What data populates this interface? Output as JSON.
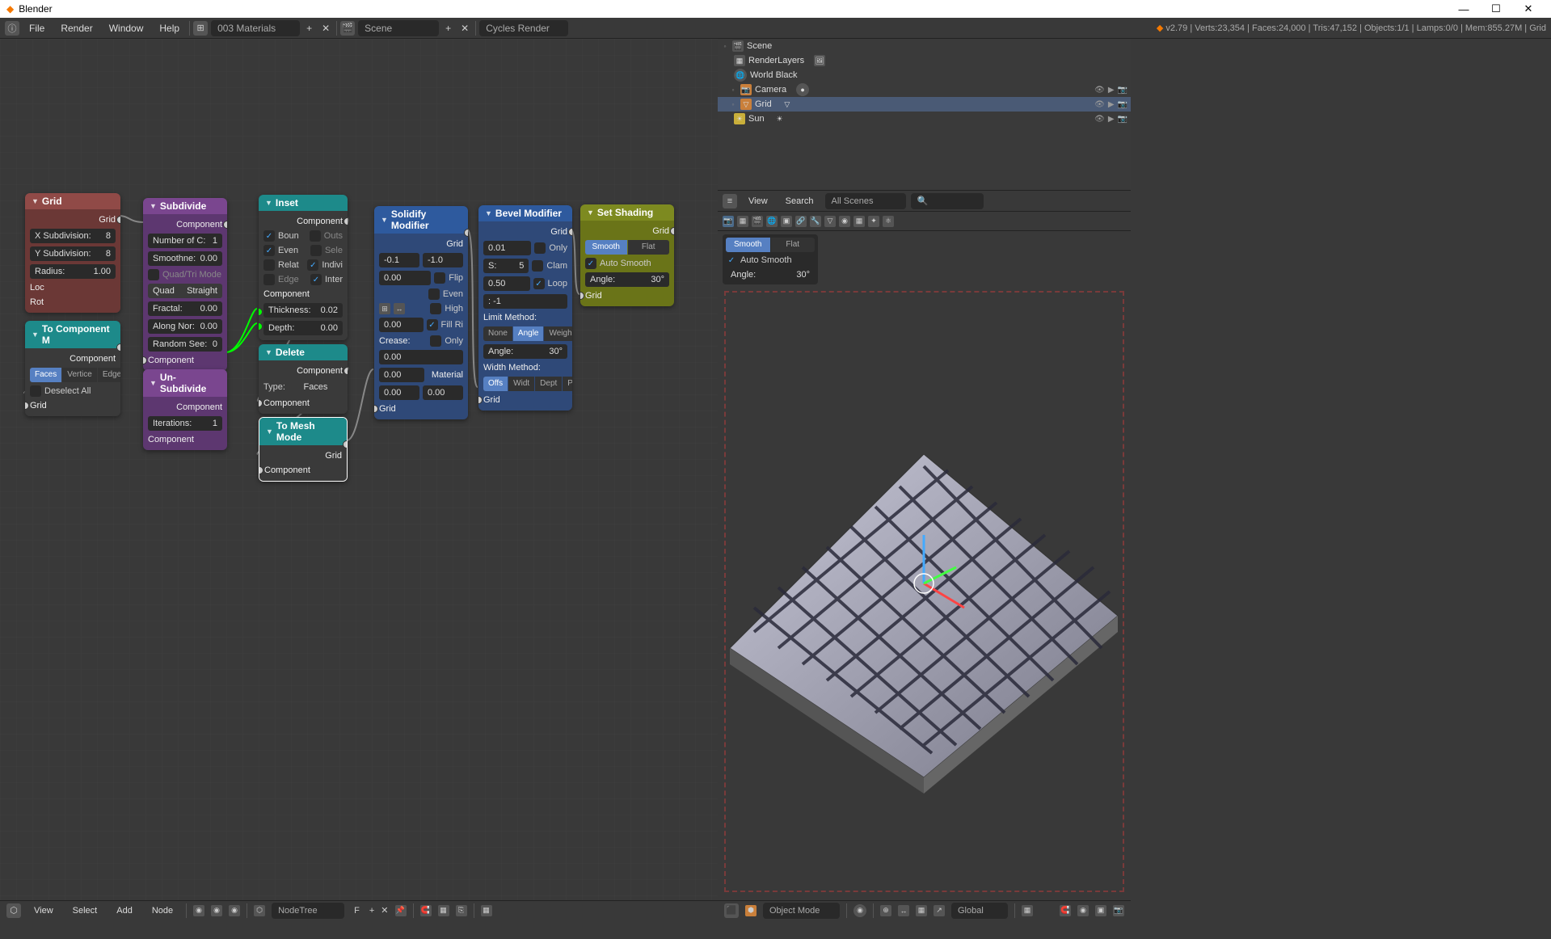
{
  "titlebar": {
    "title": "Blender"
  },
  "menu": {
    "file": "File",
    "render": "Render",
    "window": "Window",
    "help": "Help"
  },
  "header": {
    "layout_name": "003 Materials",
    "scene_name": "Scene",
    "engine": "Cycles Render",
    "stats": "v2.79 | Verts:23,354 | Faces:24,000 | Tris:47,152 | Objects:1/1 | Lamps:0/0 | Mem:855.27M | Grid"
  },
  "outliner": {
    "scene": "Scene",
    "renderlayers": "RenderLayers",
    "world": "World Black",
    "camera": "Camera",
    "grid": "Grid",
    "sun": "Sun"
  },
  "viewport_header": {
    "view": "View",
    "search": "Search",
    "all_scenes": "All Scenes"
  },
  "shading_panel": {
    "smooth": "Smooth",
    "flat": "Flat",
    "autosmooth": "Auto Smooth",
    "angle_label": "Angle:",
    "angle_val": "30°"
  },
  "bottombar_left": {
    "view": "View",
    "select": "Select",
    "add": "Add",
    "node": "Node",
    "nodetree": "NodeTree",
    "f": "F"
  },
  "bottombar_right": {
    "objmode": "Object Mode",
    "global": "Global"
  },
  "nodes": {
    "grid": {
      "title": "Grid",
      "out": "Grid",
      "xsub_l": "X Subdivision:",
      "xsub_v": "8",
      "ysub_l": "Y Subdivision:",
      "ysub_v": "8",
      "rad_l": "Radius:",
      "rad_v": "1.00",
      "loc": "Loc",
      "rot": "Rot"
    },
    "tocomp": {
      "title": "To Component M",
      "out": "Component",
      "faces": "Faces",
      "vertice": "Vertice",
      "edges": "Edges",
      "deselect": "Deselect All",
      "in": "Grid"
    },
    "subdivide": {
      "title": "Subdivide",
      "out": "Component",
      "numc_l": "Number of C:",
      "numc_v": "1",
      "smooth_l": "Smoothne:",
      "smooth_v": "0.00",
      "quadtri": "Quad/Tri Mode",
      "quad_l": "Quad",
      "quad_v": "Straight",
      "frac_l": "Fractal:",
      "frac_v": "0.00",
      "along_l": "Along Nor:",
      "along_v": "0.00",
      "seed_l": "Random See:",
      "seed_v": "0",
      "in": "Component"
    },
    "unsub": {
      "title": "Un-Subdivide",
      "out": "Component",
      "iter_l": "Iterations:",
      "iter_v": "1",
      "in": "Component"
    },
    "inset": {
      "title": "Inset",
      "out": "Component",
      "boun": "Boun",
      "outs": "Outs",
      "even": "Even",
      "sele": "Sele",
      "relat": "Relat",
      "indivi": "Indivi",
      "edge": "Edge",
      "inter": "Inter",
      "comp_hdr": "Component",
      "thick_l": "Thickness:",
      "thick_v": "0.02",
      "depth_l": "Depth:",
      "depth_v": "0.00"
    },
    "delete": {
      "title": "Delete",
      "out": "Component",
      "type_l": "Type:",
      "type_v": "Faces",
      "in": "Component"
    },
    "tomesh": {
      "title": "To Mesh Mode",
      "out": "Grid",
      "in": "Component"
    },
    "solidify": {
      "title": "Solidify Modifier",
      "out": "Grid",
      "v1": "-0.1",
      "v2": "-1.0",
      "v3": "0.00",
      "flip": "Flip",
      "even": "Even",
      "high": "High",
      "fillri": "Fill Ri",
      "only": "Only",
      "crease": "Crease:",
      "c1": "0.00",
      "c2": "0.00",
      "c3": "0.00",
      "material": "Material",
      "m1": "0.00",
      "m2": "0.00",
      "in": "Grid"
    },
    "bevel": {
      "title": "Bevel Modifier",
      "out": "Grid",
      "w": "0.01",
      "only": "Only",
      "seg_l": "S:",
      "seg_v": "5",
      "clam": "Clam",
      "prof": "0.50",
      "loop": "Loop",
      "mat": ":  -1",
      "limit": "Limit Method:",
      "none": "None",
      "angle": "Angle",
      "weigh": "Weigh",
      "angle_l": "Angle:",
      "angle_v": "30°",
      "width": "Width Method:",
      "offs": "Offs",
      "widt": "Widt",
      "dept": "Dept",
      "perc": "Perc",
      "in": "Grid"
    },
    "shading": {
      "title": "Set Shading",
      "out": "Grid",
      "smooth": "Smooth",
      "flat": "Flat",
      "autosmooth": "Auto Smooth",
      "angle_l": "Angle:",
      "angle_v": "30°",
      "in": "Grid"
    }
  }
}
